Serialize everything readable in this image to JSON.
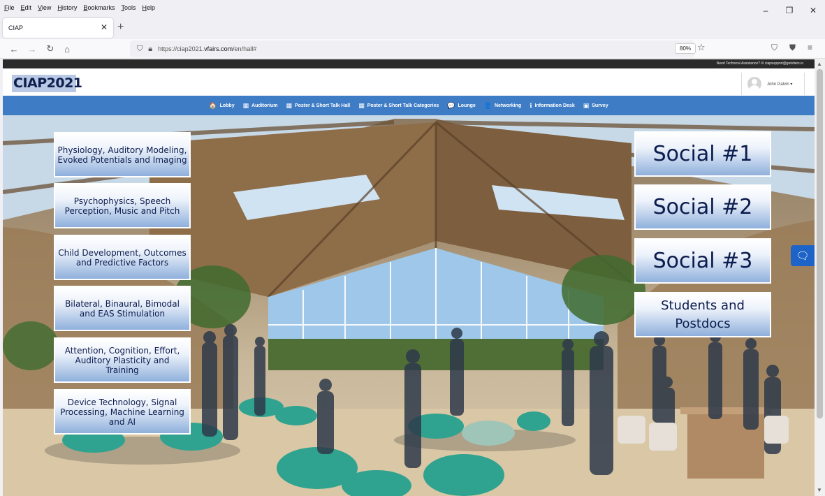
{
  "browser": {
    "menu": [
      "File",
      "Edit",
      "View",
      "History",
      "Bookmarks",
      "Tools",
      "Help"
    ],
    "window_controls": [
      "–",
      "❐",
      "✕"
    ],
    "tab": {
      "title": "CIAP",
      "close": "✕"
    },
    "new_tab": "+",
    "url": {
      "prefix": "https://ciap2021.",
      "domain": "vfairs.com",
      "path": "/en/hall#"
    },
    "zoom": "80%"
  },
  "site": {
    "assist_text": "Need Technical Assistance? ✉ ciapsupport@getvfairs.io",
    "logo": "CIAP2021",
    "user_name": "John Galvin ▾",
    "nav": [
      {
        "icon": "🏠",
        "label": "Lobby"
      },
      {
        "icon": "▦",
        "label": "Auditorium"
      },
      {
        "icon": "▦",
        "label": "Poster & Short Talk Hall"
      },
      {
        "icon": "▦",
        "label": "Poster & Short Talk Categories"
      },
      {
        "icon": "💬",
        "label": "Lounge"
      },
      {
        "icon": "👤",
        "label": "Networking"
      },
      {
        "icon": "ℹ",
        "label": "Information Desk"
      },
      {
        "icon": "▣",
        "label": "Survey"
      }
    ]
  },
  "hall": {
    "left_buttons": [
      "Physiology, Auditory Modeling, Evoked Potentials and Imaging",
      "Psychophysics, Speech Perception, Music and Pitch",
      "Child Development, Outcomes and Predictive Factors",
      "Bilateral, Binaural, Bimodal and EAS Stimulation",
      "Attention, Cognition, Effort, Auditory Plasticity and Training",
      "Device Technology, Signal Processing, Machine Learning and AI"
    ],
    "right_buttons": [
      "Social #1",
      "Social #2",
      "Social #3",
      "Students and Postdocs"
    ]
  }
}
